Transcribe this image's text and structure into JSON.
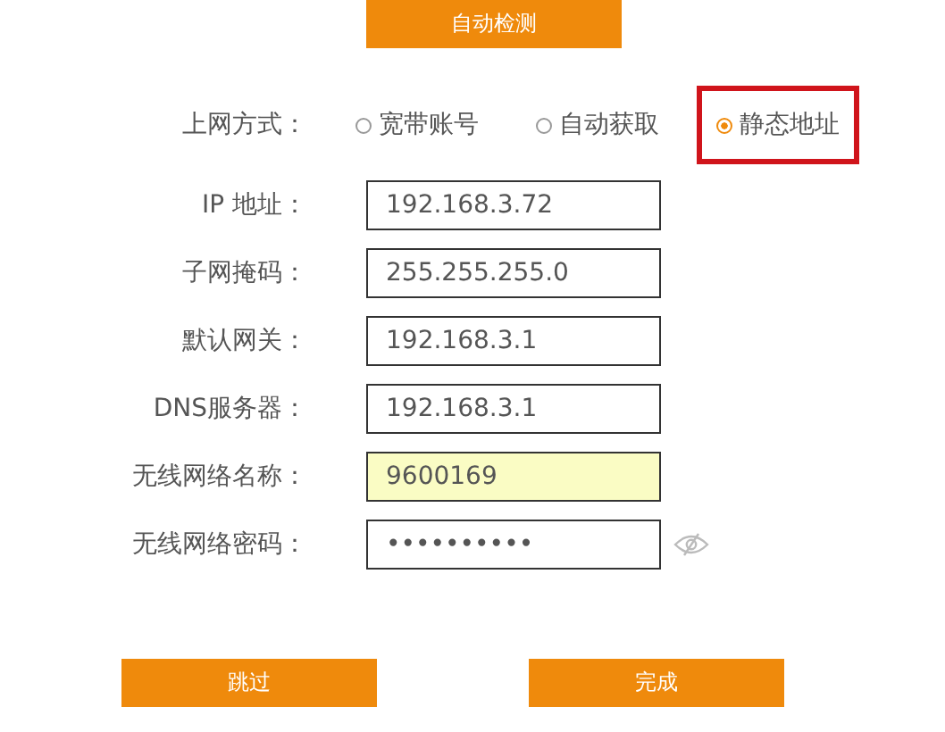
{
  "detect_button": "自动检测",
  "connection_type": {
    "label": "上网方式：",
    "options": [
      {
        "label": "宽带账号",
        "selected": false,
        "outlined": false
      },
      {
        "label": "自动获取",
        "selected": false,
        "outlined": false
      },
      {
        "label": "静态地址",
        "selected": true,
        "outlined": true
      }
    ]
  },
  "fields": [
    {
      "kind": "text",
      "label": "IP 地址：",
      "value": "192.168.3.72",
      "highlighted": false
    },
    {
      "kind": "text",
      "label": "子网掩码：",
      "value": "255.255.255.0",
      "highlighted": false
    },
    {
      "kind": "text",
      "label": "默认网关：",
      "value": "192.168.3.1",
      "highlighted": false
    },
    {
      "kind": "text",
      "label": "DNS服务器：",
      "value": "192.168.3.1",
      "highlighted": false
    },
    {
      "kind": "text",
      "label": "无线网络名称：",
      "value": "9600169",
      "highlighted": true
    },
    {
      "kind": "password",
      "label": "无线网络密码：",
      "value": "••••••••••",
      "highlighted": false
    }
  ],
  "buttons": [
    "跳过",
    "完成"
  ]
}
